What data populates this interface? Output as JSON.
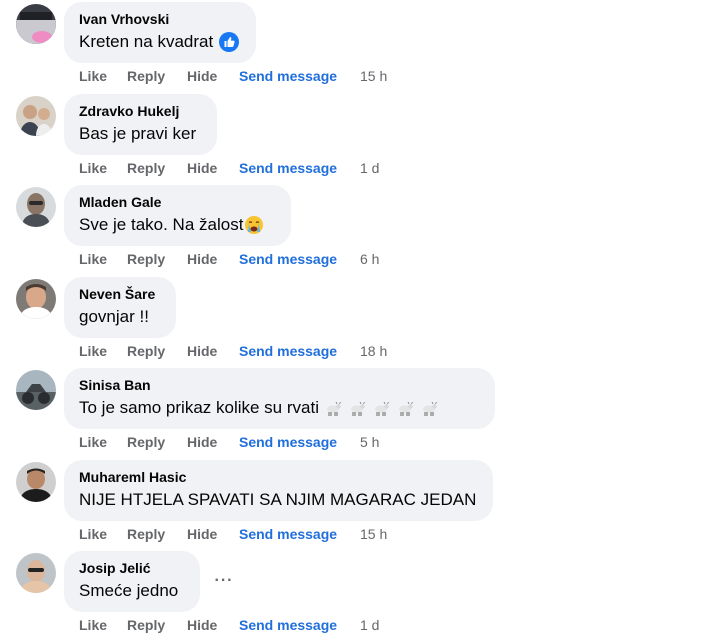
{
  "comments": [
    {
      "author": "Ivan Vrhovski",
      "text": "Kreten na kvadrat",
      "time": "15 h",
      "reaction": "like-reaction-icon"
    },
    {
      "author": "Zdravko Hukelj",
      "text": "Bas je pravi ker",
      "time": "1 d"
    },
    {
      "author": "Mladen Gale",
      "text": "Sve je tako. Na žalost",
      "time": "6 h",
      "emoji": "crying-face-emoji"
    },
    {
      "author": "Neven Šare",
      "text": "govnjar !!",
      "time": "18 h"
    },
    {
      "author": "Sinisa Ban",
      "text": "To je samo prikaz kolike su rvati",
      "time": "5 h",
      "emoji": "goat-emoji"
    },
    {
      "author": "Muhareml Hasic",
      "text": "NIJE HTJELA SPAVATI SA NJIM MAGARAC JEDAN",
      "time": "15 h"
    },
    {
      "author": "Josip Jelić",
      "text": "Smeće jedno",
      "time": "1 d",
      "more": "more-options-icon"
    }
  ],
  "actions": {
    "like": "Like",
    "reply": "Reply",
    "hide": "Hide",
    "send_message": "Send message"
  },
  "more_glyph": "···",
  "colors": {
    "bubble": "#f0f2f5",
    "link": "#216fdb",
    "muted": "#65676b",
    "like_blue": "#1877f2"
  }
}
